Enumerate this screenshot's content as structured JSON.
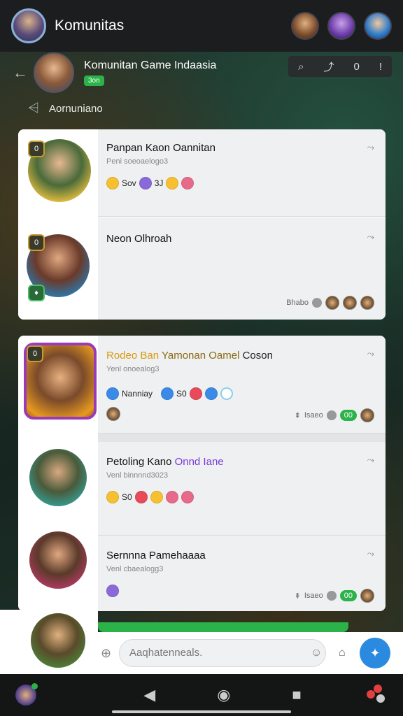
{
  "app": {
    "title": "Komunitas"
  },
  "group": {
    "name": "Komunitan Game Indaasia",
    "badge": "3on",
    "sub_label": "Aornuniano",
    "actions": {
      "search": "⌕",
      "share": "⤴",
      "mode": "0",
      "more": "!"
    }
  },
  "cards": [
    {
      "title": "Panpan Kaon Oannitan",
      "sub": "Peni soeoaelogo3",
      "reacts": [
        "y",
        "Sov",
        "p",
        "3J",
        "y",
        "k"
      ],
      "meta": "",
      "badge": "0"
    },
    {
      "title": "Neon Olhroah",
      "sub": "",
      "meta_text": "Bhabo",
      "badge": "0"
    },
    {
      "title_prefix": "Rodeo Ban",
      "title_mid": " Yamonan Oamel",
      "title_suffix": " Coson",
      "sub": "Yenl onoealog3",
      "react_label": "Nanniay",
      "react_count": "S0",
      "meta_text": "Isaeo",
      "online": "00",
      "badge": "0"
    },
    {
      "title_prefix": "Petoling Kano",
      "title_mid": " Onnd Iane",
      "sub": "Venl binnnnd3023",
      "react_count": "S0"
    },
    {
      "title": "Sernnna Pamehaaaa",
      "sub": "Venl cbaealogg3",
      "meta_text": "Isaeo",
      "online": "00"
    }
  ],
  "composer": {
    "placeholder": "Aaqhatenneals."
  },
  "nav": {
    "back": "◀",
    "home": "◉",
    "recent": "■"
  }
}
